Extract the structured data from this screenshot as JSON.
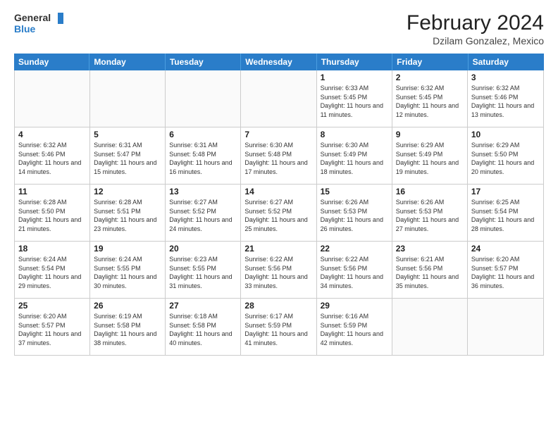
{
  "header": {
    "title": "February 2024",
    "subtitle": "Dzilam Gonzalez, Mexico",
    "logo_general": "General",
    "logo_blue": "Blue"
  },
  "days_of_week": [
    "Sunday",
    "Monday",
    "Tuesday",
    "Wednesday",
    "Thursday",
    "Friday",
    "Saturday"
  ],
  "weeks": [
    [
      {
        "day": "",
        "info": ""
      },
      {
        "day": "",
        "info": ""
      },
      {
        "day": "",
        "info": ""
      },
      {
        "day": "",
        "info": ""
      },
      {
        "day": "1",
        "info": "Sunrise: 6:33 AM\nSunset: 5:45 PM\nDaylight: 11 hours and 11 minutes."
      },
      {
        "day": "2",
        "info": "Sunrise: 6:32 AM\nSunset: 5:45 PM\nDaylight: 11 hours and 12 minutes."
      },
      {
        "day": "3",
        "info": "Sunrise: 6:32 AM\nSunset: 5:46 PM\nDaylight: 11 hours and 13 minutes."
      }
    ],
    [
      {
        "day": "4",
        "info": "Sunrise: 6:32 AM\nSunset: 5:46 PM\nDaylight: 11 hours and 14 minutes."
      },
      {
        "day": "5",
        "info": "Sunrise: 6:31 AM\nSunset: 5:47 PM\nDaylight: 11 hours and 15 minutes."
      },
      {
        "day": "6",
        "info": "Sunrise: 6:31 AM\nSunset: 5:48 PM\nDaylight: 11 hours and 16 minutes."
      },
      {
        "day": "7",
        "info": "Sunrise: 6:30 AM\nSunset: 5:48 PM\nDaylight: 11 hours and 17 minutes."
      },
      {
        "day": "8",
        "info": "Sunrise: 6:30 AM\nSunset: 5:49 PM\nDaylight: 11 hours and 18 minutes."
      },
      {
        "day": "9",
        "info": "Sunrise: 6:29 AM\nSunset: 5:49 PM\nDaylight: 11 hours and 19 minutes."
      },
      {
        "day": "10",
        "info": "Sunrise: 6:29 AM\nSunset: 5:50 PM\nDaylight: 11 hours and 20 minutes."
      }
    ],
    [
      {
        "day": "11",
        "info": "Sunrise: 6:28 AM\nSunset: 5:50 PM\nDaylight: 11 hours and 21 minutes."
      },
      {
        "day": "12",
        "info": "Sunrise: 6:28 AM\nSunset: 5:51 PM\nDaylight: 11 hours and 23 minutes."
      },
      {
        "day": "13",
        "info": "Sunrise: 6:27 AM\nSunset: 5:52 PM\nDaylight: 11 hours and 24 minutes."
      },
      {
        "day": "14",
        "info": "Sunrise: 6:27 AM\nSunset: 5:52 PM\nDaylight: 11 hours and 25 minutes."
      },
      {
        "day": "15",
        "info": "Sunrise: 6:26 AM\nSunset: 5:53 PM\nDaylight: 11 hours and 26 minutes."
      },
      {
        "day": "16",
        "info": "Sunrise: 6:26 AM\nSunset: 5:53 PM\nDaylight: 11 hours and 27 minutes."
      },
      {
        "day": "17",
        "info": "Sunrise: 6:25 AM\nSunset: 5:54 PM\nDaylight: 11 hours and 28 minutes."
      }
    ],
    [
      {
        "day": "18",
        "info": "Sunrise: 6:24 AM\nSunset: 5:54 PM\nDaylight: 11 hours and 29 minutes."
      },
      {
        "day": "19",
        "info": "Sunrise: 6:24 AM\nSunset: 5:55 PM\nDaylight: 11 hours and 30 minutes."
      },
      {
        "day": "20",
        "info": "Sunrise: 6:23 AM\nSunset: 5:55 PM\nDaylight: 11 hours and 31 minutes."
      },
      {
        "day": "21",
        "info": "Sunrise: 6:22 AM\nSunset: 5:56 PM\nDaylight: 11 hours and 33 minutes."
      },
      {
        "day": "22",
        "info": "Sunrise: 6:22 AM\nSunset: 5:56 PM\nDaylight: 11 hours and 34 minutes."
      },
      {
        "day": "23",
        "info": "Sunrise: 6:21 AM\nSunset: 5:56 PM\nDaylight: 11 hours and 35 minutes."
      },
      {
        "day": "24",
        "info": "Sunrise: 6:20 AM\nSunset: 5:57 PM\nDaylight: 11 hours and 36 minutes."
      }
    ],
    [
      {
        "day": "25",
        "info": "Sunrise: 6:20 AM\nSunset: 5:57 PM\nDaylight: 11 hours and 37 minutes."
      },
      {
        "day": "26",
        "info": "Sunrise: 6:19 AM\nSunset: 5:58 PM\nDaylight: 11 hours and 38 minutes."
      },
      {
        "day": "27",
        "info": "Sunrise: 6:18 AM\nSunset: 5:58 PM\nDaylight: 11 hours and 40 minutes."
      },
      {
        "day": "28",
        "info": "Sunrise: 6:17 AM\nSunset: 5:59 PM\nDaylight: 11 hours and 41 minutes."
      },
      {
        "day": "29",
        "info": "Sunrise: 6:16 AM\nSunset: 5:59 PM\nDaylight: 11 hours and 42 minutes."
      },
      {
        "day": "",
        "info": ""
      },
      {
        "day": "",
        "info": ""
      }
    ]
  ]
}
